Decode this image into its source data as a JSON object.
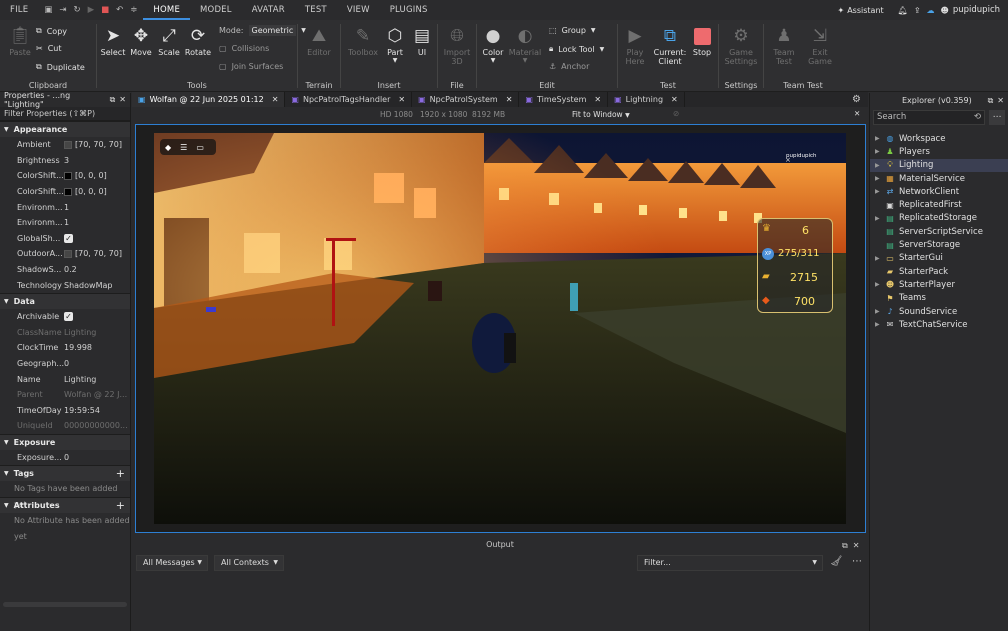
{
  "menubar": {
    "items": [
      "FILE",
      "HOME",
      "MODEL",
      "AVATAR",
      "TEST",
      "VIEW",
      "PLUGINS"
    ],
    "active": "HOME",
    "assistant": "Assistant",
    "username": "pupidupich"
  },
  "ribbon": {
    "clipboard": {
      "label": "Clipboard",
      "paste": "Paste",
      "copy": "Copy",
      "cut": "Cut",
      "duplicate": "Duplicate"
    },
    "tools": {
      "label": "Tools",
      "select": "Select",
      "move": "Move",
      "scale": "Scale",
      "rotate": "Rotate",
      "mode_label": "Mode:",
      "mode_value": "Geometric",
      "collisions": "Collisions",
      "join_surfaces": "Join Surfaces"
    },
    "terrain": {
      "label": "Terrain",
      "editor": "Editor"
    },
    "insert": {
      "label": "Insert",
      "toolbox": "Toolbox",
      "part": "Part",
      "ui": "UI"
    },
    "file": {
      "label": "File",
      "import_3d_line1": "Import",
      "import_3d_line2": "3D"
    },
    "edit": {
      "label": "Edit",
      "color": "Color",
      "material": "Material",
      "group": "Group",
      "lock_tool": "Lock Tool",
      "anchor": "Anchor"
    },
    "test": {
      "label": "Test",
      "play_here_line1": "Play",
      "play_here_line2": "Here",
      "current_client_line1": "Current:",
      "current_client_line2": "Client",
      "stop": "Stop"
    },
    "settings": {
      "label": "Settings",
      "game_settings_line1": "Game",
      "game_settings_line2": "Settings"
    },
    "team_test": {
      "label": "Team Test",
      "team_test_line1": "Team",
      "team_test_line2": "Test",
      "exit_game_line1": "Exit",
      "exit_game_line2": "Game"
    }
  },
  "properties": {
    "title": "Properties - ...ng \"Lighting\"",
    "filter": "Filter Properties (⇧⌘P)",
    "sections": {
      "appearance": "Appearance",
      "data": "Data",
      "exposure": "Exposure",
      "tags": "Tags",
      "attributes": "Attributes"
    },
    "appearance": [
      {
        "k": "Ambient",
        "v": "[70, 70, 70]",
        "swatch": "#464646"
      },
      {
        "k": "Brightness",
        "v": "3"
      },
      {
        "k": "ColorShift...",
        "v": "[0, 0, 0]",
        "swatch": "#000000"
      },
      {
        "k": "ColorShift...",
        "v": "[0, 0, 0]",
        "swatch": "#000000"
      },
      {
        "k": "Environm...",
        "v": "1"
      },
      {
        "k": "Environm...",
        "v": "1"
      },
      {
        "k": "GlobalSh...",
        "check": true
      },
      {
        "k": "OutdoorA...",
        "v": "[70, 70, 70]",
        "swatch": "#464646"
      },
      {
        "k": "ShadowS...",
        "v": "0.2"
      },
      {
        "k": "Technology",
        "v": "ShadowMap"
      }
    ],
    "data": [
      {
        "k": "Archivable",
        "check": true
      },
      {
        "k": "ClassName",
        "v": "Lighting",
        "ro": true
      },
      {
        "k": "ClockTime",
        "v": "19.998"
      },
      {
        "k": "Geograph...",
        "v": "0"
      },
      {
        "k": "Name",
        "v": "Lighting"
      },
      {
        "k": "Parent",
        "v": "Wolfan @ 22 J...",
        "ro": true
      },
      {
        "k": "TimeOfDay",
        "v": "19:59:54"
      },
      {
        "k": "UniqueId",
        "v": "00000000000...",
        "ro": true
      }
    ],
    "exposure": [
      {
        "k": "Exposure...",
        "v": "0"
      }
    ],
    "tags_empty": "No Tags have been added yet",
    "attributes_empty": "No Attribute has been added yet"
  },
  "tabs": [
    {
      "label": "Wolfan @ 22 Jun 2025 01:12",
      "active": true
    },
    {
      "label": "NpcPatrolTagsHandler"
    },
    {
      "label": "NpcPatrolSystem"
    },
    {
      "label": "TimeSystem"
    },
    {
      "label": "Lightning"
    }
  ],
  "viewport": {
    "resolution": "HD 1080",
    "size": "1920 x 1080",
    "memory": "8192 MB",
    "fit": "Fit to Window"
  },
  "game_hud": {
    "player_name": "pupidupich",
    "level": "6",
    "xp": "275/311",
    "xp_label": "XP",
    "coins": "2715",
    "gems": "700"
  },
  "output": {
    "title": "Output",
    "messages": "All Messages",
    "contexts": "All Contexts",
    "filter_placeholder": "Filter..."
  },
  "explorer": {
    "title": "Explorer (v0.359)",
    "search_placeholder": "Search",
    "items": [
      {
        "label": "Workspace",
        "icon": "globe-icon",
        "color": "#4aa3e8",
        "expand": true
      },
      {
        "label": "Players",
        "icon": "players-icon",
        "color": "#7ac943",
        "expand": true
      },
      {
        "label": "Lighting",
        "icon": "lightbulb-icon",
        "color": "#f2d33b",
        "expand": true,
        "selected": true
      },
      {
        "label": "MaterialService",
        "icon": "material-icon",
        "color": "#e8a23a",
        "expand": true
      },
      {
        "label": "NetworkClient",
        "icon": "network-icon",
        "color": "#5ba7e6",
        "expand": true
      },
      {
        "label": "ReplicatedFirst",
        "icon": "replicated-first-icon",
        "color": "#d8d8d8",
        "expand": false
      },
      {
        "label": "ReplicatedStorage",
        "icon": "replicated-storage-icon",
        "color": "#3fb27f",
        "expand": true
      },
      {
        "label": "ServerScriptService",
        "icon": "server-script-icon",
        "color": "#3fb27f",
        "expand": false
      },
      {
        "label": "ServerStorage",
        "icon": "server-storage-icon",
        "color": "#3fb27f",
        "expand": false
      },
      {
        "label": "StarterGui",
        "icon": "starter-gui-icon",
        "color": "#e8c86b",
        "expand": true
      },
      {
        "label": "StarterPack",
        "icon": "starter-pack-icon",
        "color": "#e8c86b",
        "expand": false
      },
      {
        "label": "StarterPlayer",
        "icon": "starter-player-icon",
        "color": "#e8c86b",
        "expand": true
      },
      {
        "label": "Teams",
        "icon": "teams-icon",
        "color": "#e8c86b",
        "expand": false
      },
      {
        "label": "SoundService",
        "icon": "sound-icon",
        "color": "#5ba7e6",
        "expand": true
      },
      {
        "label": "TextChatService",
        "icon": "chat-icon",
        "color": "#d8d8d8",
        "expand": true
      }
    ]
  }
}
